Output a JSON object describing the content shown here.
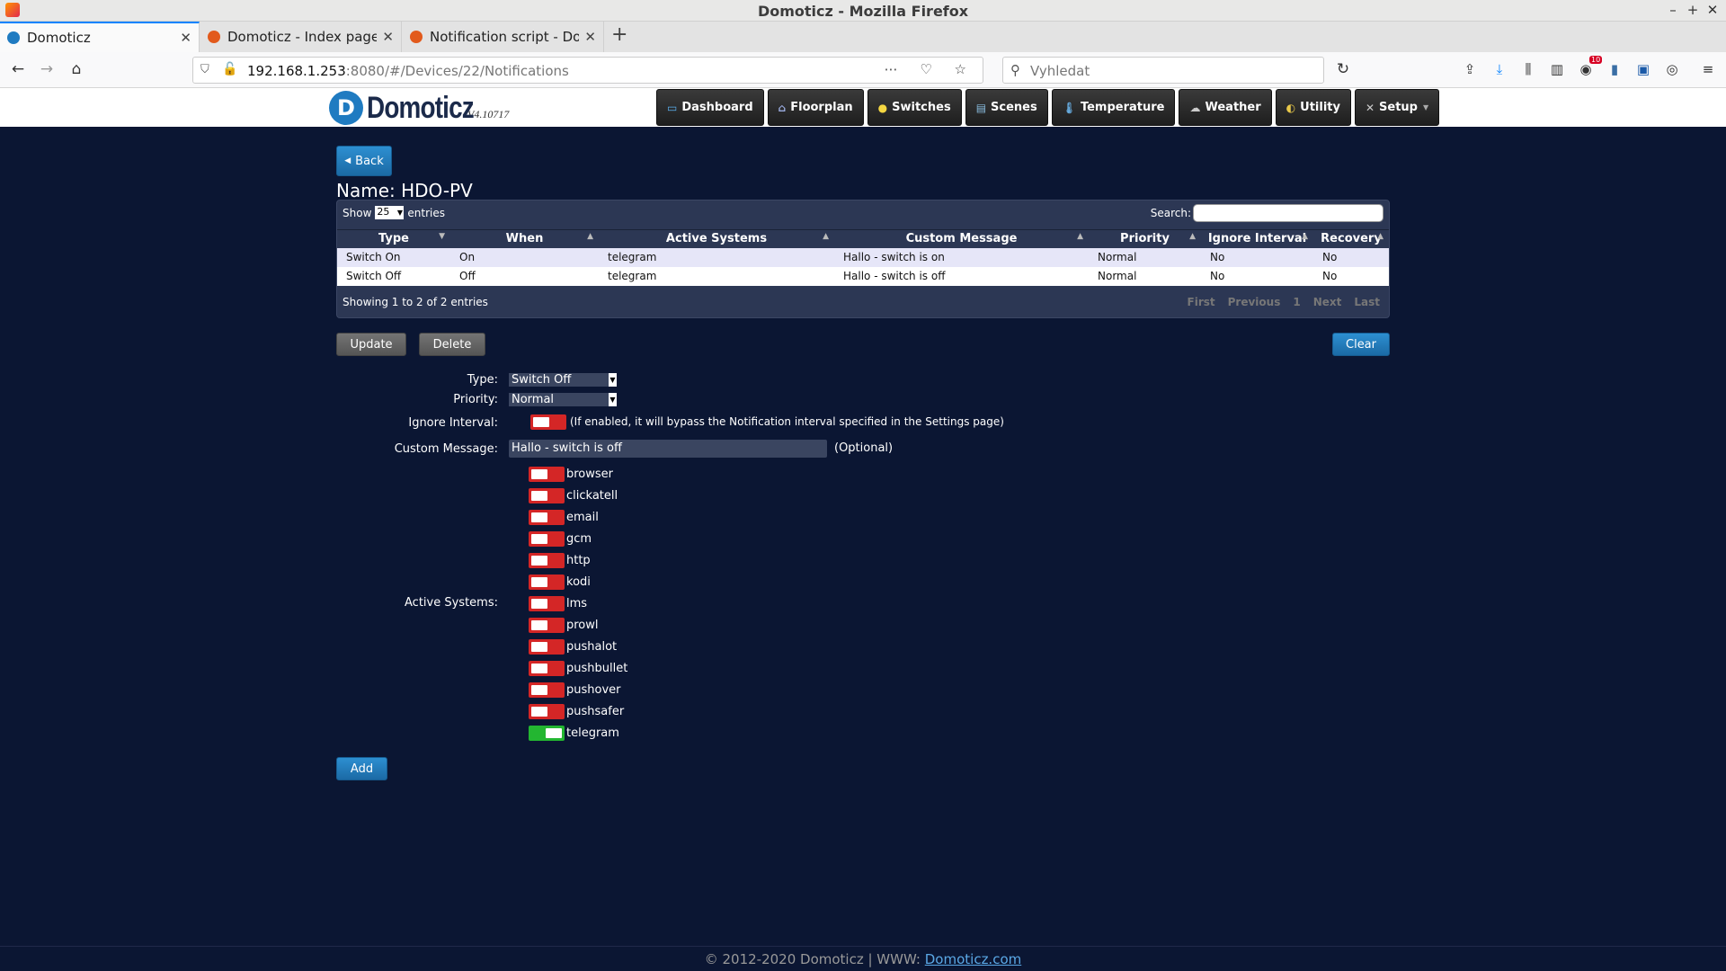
{
  "browser": {
    "window_title": "Domoticz - Mozilla Firefox",
    "tabs": [
      {
        "label": "Domoticz",
        "active": true
      },
      {
        "label": "Domoticz - Index page",
        "active": false
      },
      {
        "label": "Notification script - Dom",
        "active": false
      }
    ],
    "url_host": "192.168.1.253",
    "url_rest": ":8080/#/Devices/22/Notifications",
    "search_placeholder": "Vyhledat",
    "badge_count": "10"
  },
  "app": {
    "logo_text": "Domoticz",
    "version": "V4.10717",
    "nav": [
      {
        "label": "Dashboard",
        "icon": "dashboard-icon"
      },
      {
        "label": "Floorplan",
        "icon": "floorplan-icon"
      },
      {
        "label": "Switches",
        "icon": "lightbulb-icon"
      },
      {
        "label": "Scenes",
        "icon": "scenes-icon"
      },
      {
        "label": "Temperature",
        "icon": "thermometer-icon"
      },
      {
        "label": "Weather",
        "icon": "weather-icon"
      },
      {
        "label": "Utility",
        "icon": "utility-icon"
      },
      {
        "label": "Setup",
        "icon": "tools-icon"
      }
    ]
  },
  "page": {
    "back_label": "Back",
    "title": "Name: HDO-PV",
    "show_label": "Show",
    "entries_value": "25",
    "entries_label": "entries",
    "search_label": "Search:",
    "columns": [
      "Type",
      "When",
      "Active Systems",
      "Custom Message",
      "Priority",
      "Ignore Interval",
      "Recovery"
    ],
    "rows": [
      [
        "Switch On",
        "On",
        "telegram",
        "Hallo - switch is on",
        "Normal",
        "No",
        "No"
      ],
      [
        "Switch Off",
        "Off",
        "telegram",
        "Hallo - switch is off",
        "Normal",
        "No",
        "No"
      ]
    ],
    "info": "Showing 1 to 2 of 2 entries",
    "paging": [
      "First",
      "Previous",
      "1",
      "Next",
      "Last"
    ],
    "update_label": "Update",
    "delete_label": "Delete",
    "clear_label": "Clear",
    "add_label": "Add"
  },
  "form": {
    "type_label": "Type:",
    "type_value": "Switch Off",
    "priority_label": "Priority:",
    "priority_value": "Normal",
    "ignore_label": "Ignore Interval:",
    "ignore_note": "(If enabled, it will bypass the Notification interval specified in the Settings page)",
    "ignore_enabled": false,
    "message_label": "Custom Message:",
    "message_value": "Hallo - switch is off",
    "message_note": "(Optional)",
    "systems_label": "Active Systems:",
    "systems": [
      {
        "name": "browser",
        "enabled": false
      },
      {
        "name": "clickatell",
        "enabled": false
      },
      {
        "name": "email",
        "enabled": false
      },
      {
        "name": "gcm",
        "enabled": false
      },
      {
        "name": "http",
        "enabled": false
      },
      {
        "name": "kodi",
        "enabled": false
      },
      {
        "name": "lms",
        "enabled": false
      },
      {
        "name": "prowl",
        "enabled": false
      },
      {
        "name": "pushalot",
        "enabled": false
      },
      {
        "name": "pushbullet",
        "enabled": false
      },
      {
        "name": "pushover",
        "enabled": false
      },
      {
        "name": "pushsafer",
        "enabled": false
      },
      {
        "name": "telegram",
        "enabled": true
      }
    ]
  },
  "footer": {
    "copyright": "© 2012-2020 Domoticz | WWW: ",
    "link": "Domoticz.com"
  },
  "colors": {
    "page_bg": "#0b1633",
    "toggle_off": "#d42626",
    "toggle_on": "#23b631",
    "accent_blue": "#1f7bc1"
  }
}
